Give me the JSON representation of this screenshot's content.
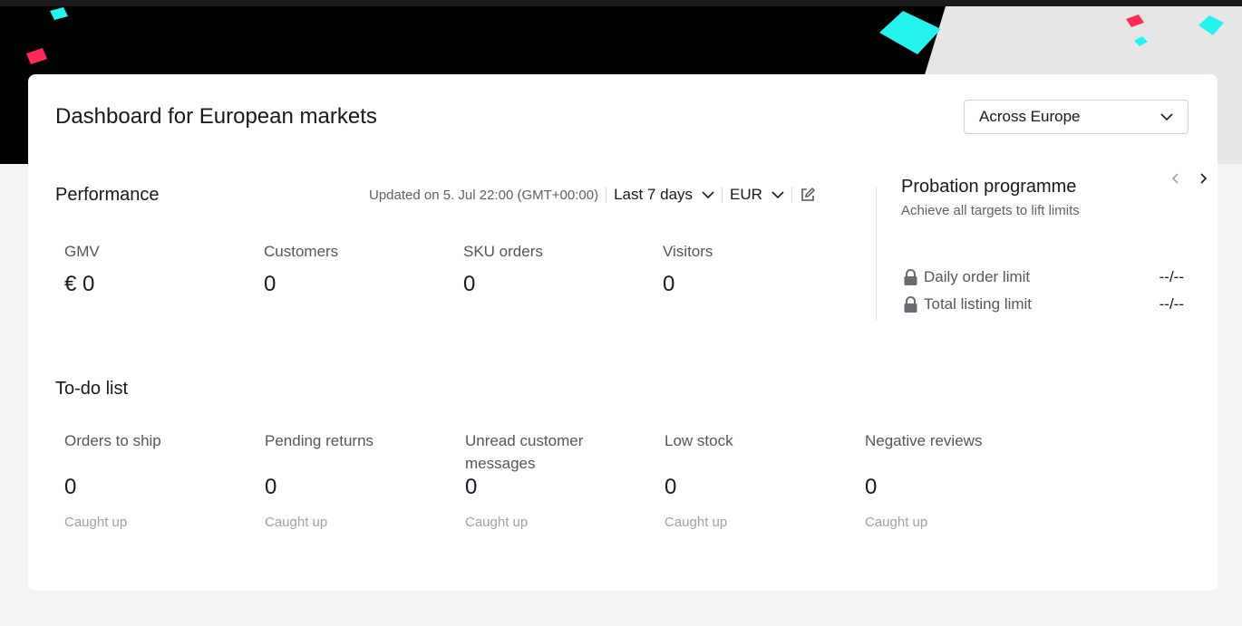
{
  "header": {
    "title": "Dashboard for European markets",
    "region_select": "Across Europe"
  },
  "performance": {
    "title": "Performance",
    "updated": "Updated on 5. Jul 22:00 (GMT+00:00)",
    "period": "Last 7 days",
    "currency": "EUR",
    "metrics": [
      {
        "label": "GMV",
        "value": "€ 0"
      },
      {
        "label": "Customers",
        "value": "0"
      },
      {
        "label": "SKU orders",
        "value": "0"
      },
      {
        "label": "Visitors",
        "value": "0"
      }
    ]
  },
  "probation": {
    "title": "Probation programme",
    "subtitle": "Achieve all targets to lift limits",
    "limits": [
      {
        "label": "Daily order limit",
        "value": "--/--"
      },
      {
        "label": "Total listing limit",
        "value": "--/--"
      }
    ]
  },
  "todo": {
    "title": "To-do list",
    "items": [
      {
        "label": "Orders to ship",
        "value": "0",
        "status": "Caught up"
      },
      {
        "label": "Pending returns",
        "value": "0",
        "status": "Caught up"
      },
      {
        "label": "Unread customer messages",
        "value": "0",
        "status": "Caught up"
      },
      {
        "label": "Low stock",
        "value": "0",
        "status": "Caught up"
      },
      {
        "label": "Negative reviews",
        "value": "0",
        "status": "Caught up"
      }
    ]
  },
  "icons": [
    "chevron-down-icon",
    "edit-icon",
    "chevron-left-icon",
    "chevron-right-icon",
    "lock-icon"
  ],
  "colors": {
    "accent_cyan": "#25f4ee",
    "accent_red": "#fe2c55",
    "banner": "#000000"
  }
}
